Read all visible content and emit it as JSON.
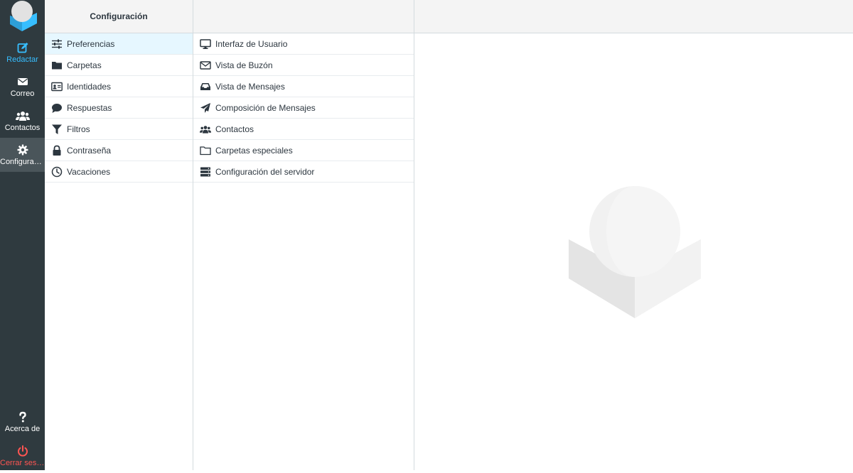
{
  "nav": {
    "items": [
      {
        "id": "compose",
        "label": "Redactar"
      },
      {
        "id": "mail",
        "label": "Correo"
      },
      {
        "id": "contacts",
        "label": "Contactos"
      },
      {
        "id": "settings",
        "label": "Configuraci…"
      },
      {
        "id": "about",
        "label": "Acerca de"
      },
      {
        "id": "logout",
        "label": "Cerrar sesión"
      }
    ]
  },
  "sections": {
    "title": "Configuración",
    "items": [
      {
        "label": "Preferencias",
        "icon": "sliders-icon"
      },
      {
        "label": "Carpetas",
        "icon": "folder-icon"
      },
      {
        "label": "Identidades",
        "icon": "id-card-icon"
      },
      {
        "label": "Respuestas",
        "icon": "comment-icon"
      },
      {
        "label": "Filtros",
        "icon": "filter-icon"
      },
      {
        "label": "Contraseña",
        "icon": "lock-icon"
      },
      {
        "label": "Vacaciones",
        "icon": "clock-icon"
      }
    ]
  },
  "prefs": {
    "items": [
      {
        "label": "Interfaz de Usuario",
        "icon": "monitor-icon"
      },
      {
        "label": "Vista de Buzón",
        "icon": "envelope-icon"
      },
      {
        "label": "Vista de Mensajes",
        "icon": "inbox-icon"
      },
      {
        "label": "Composición de Mensajes",
        "icon": "paper-plane-icon"
      },
      {
        "label": "Contactos",
        "icon": "users-icon"
      },
      {
        "label": "Carpetas especiales",
        "icon": "folder-outline-icon"
      },
      {
        "label": "Configuración del servidor",
        "icon": "server-icon"
      }
    ]
  },
  "colors": {
    "nav_bg": "#2f3a3f",
    "accent": "#37beff",
    "logout": "#ff5552",
    "selected_row": "#e6f7ff"
  }
}
